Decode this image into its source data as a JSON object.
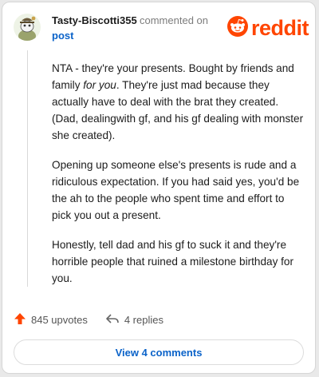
{
  "comment": {
    "username": "Tasty-Biscotti355",
    "action_text": "commented on",
    "post_link": "post",
    "paragraphs": {
      "p1_a": "NTA - they're your presents. Bought by friends and family ",
      "p1_em": "for you",
      "p1_b": ". They're just mad because they actually have to deal with the brat they created. (Dad, dealingwith gf, and his gf dealing with monster she created).",
      "p2": "Opening up someone else's presents is rude and a ridiculous expectation. If you had said yes, you'd be the ah to the people who spent time and effort to pick you out a present.",
      "p3": "Honestly, tell dad and his gf to suck it and they're horrible people that ruined a milestone birthday for you."
    }
  },
  "brand": {
    "name": "reddit",
    "color": "#ff4500"
  },
  "actions": {
    "upvotes": "845 upvotes",
    "replies": "4 replies"
  },
  "footer": {
    "view_comments": "View 4 comments"
  },
  "icons": {
    "avatar": "snoo-avatar-icon",
    "logo": "reddit-alien-icon",
    "upvote": "upvote-arrow-icon",
    "reply": "reply-arrow-icon"
  }
}
